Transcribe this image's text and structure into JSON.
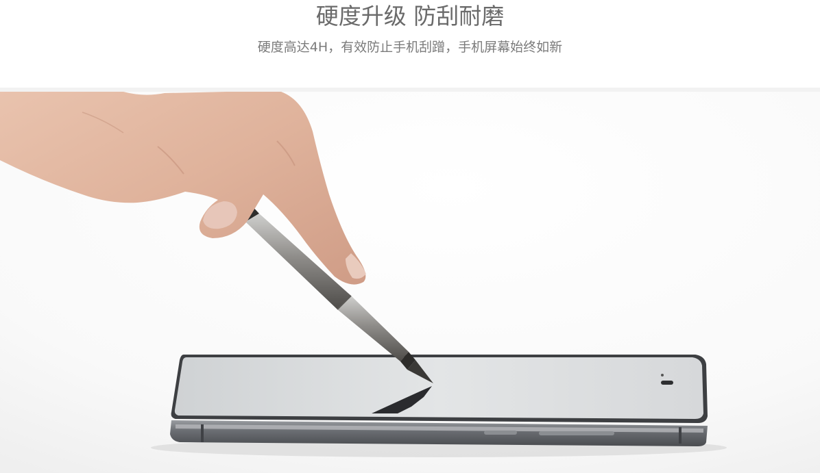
{
  "header": {
    "title": "硬度升级 防刮耐磨",
    "subtitle": "硬度高达4H，有效防止手机刮蹭，手机屏幕始终如新"
  },
  "photo": {
    "subject": "hand-pen-scratching-phone-screen"
  },
  "colors": {
    "title": "#6a6a6a",
    "subtitle": "#7b7b7b",
    "divider": "#f2f2f2"
  }
}
